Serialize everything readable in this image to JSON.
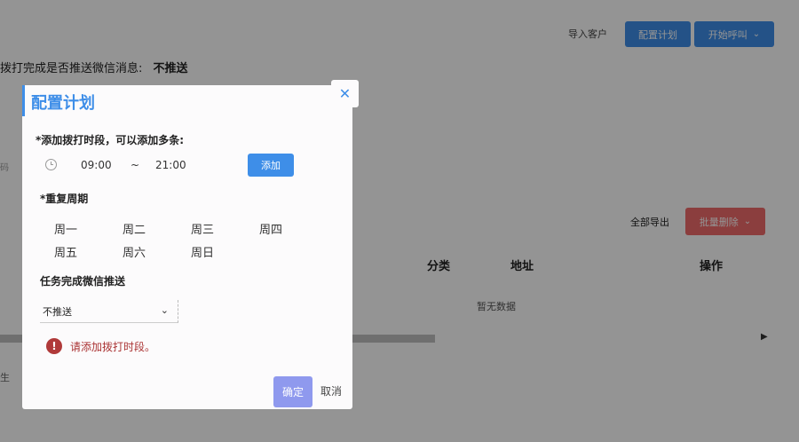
{
  "background": {
    "toolbar": {
      "import_label": "导入客户",
      "config_label": "配置计划",
      "call_label": "开始呼叫"
    },
    "push_setting": {
      "label": "拨打完成是否推送微信消息:",
      "value": "不推送"
    },
    "left_stubs": [
      "码",
      "生"
    ],
    "table_actions": {
      "export_label": "全部导出",
      "batch_delete_label": "批量删除"
    },
    "table": {
      "headers": [
        "分类",
        "地址",
        "操作"
      ],
      "empty_text": "暂无数据"
    }
  },
  "dialog": {
    "title": "配置计划",
    "time_section_label": "*添加拨打时段，可以添加多条:",
    "time_start": "09:00",
    "time_separator": "~",
    "time_end": "21:00",
    "add_label": "添加",
    "repeat_label": "*重复周期",
    "days": [
      "周一",
      "周二",
      "周三",
      "周四",
      "周五",
      "周六",
      "周日"
    ],
    "push_label": "任务完成微信推送",
    "push_selected": "不推送",
    "error_text": "请添加拨打时段。",
    "ok_label": "确定",
    "cancel_label": "取消"
  },
  "colors": {
    "accent": "#3e8ee8",
    "danger": "#f06b6b",
    "error_text": "#aa3333",
    "ok_button": "#8f99ee"
  },
  "icons": [
    "close-icon",
    "clock-icon",
    "chevron-down-icon",
    "error-icon",
    "scroll-right-arrow-icon"
  ]
}
